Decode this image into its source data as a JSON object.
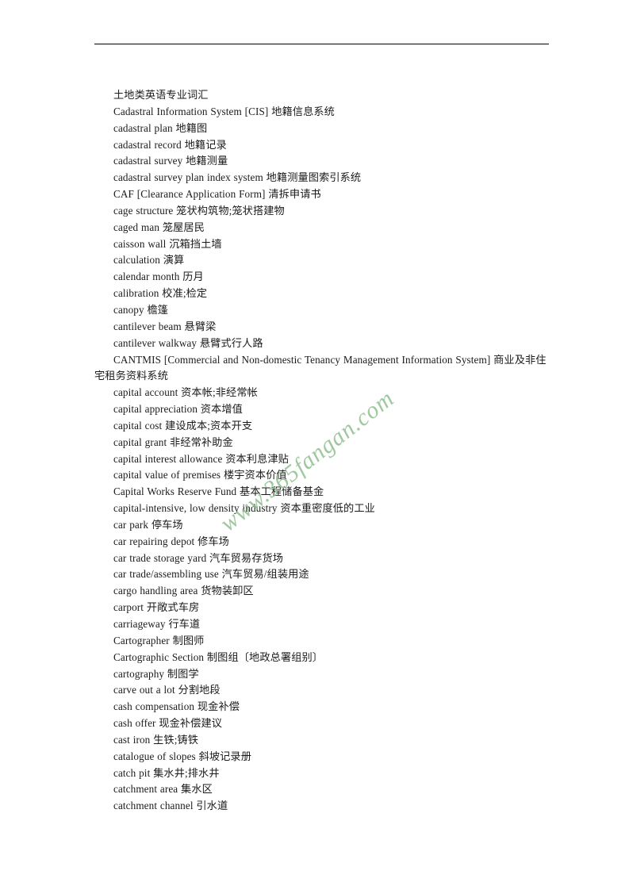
{
  "document": {
    "title": "土地类英语专业词汇",
    "header_rule": true,
    "watermark": {
      "text": "www.365fangan.com",
      "color": "#8fbf8f",
      "rotation_deg": -38
    }
  },
  "entries": [
    {
      "line": "土地类英语专业词汇"
    },
    {
      "line": "Cadastral Information System [CIS]  地籍信息系统"
    },
    {
      "line": "cadastral plan  地籍图"
    },
    {
      "line": "cadastral record  地籍记录"
    },
    {
      "line": "cadastral survey  地籍测量"
    },
    {
      "line": "cadastral survey plan index system  地籍测量图索引系统"
    },
    {
      "line": "CAF [Clearance Application Form]  清拆申请书"
    },
    {
      "line": "cage structure  笼状构筑物;笼状搭建物"
    },
    {
      "line": "caged man  笼屋居民"
    },
    {
      "line": "caisson wall  沉箱挡土墙"
    },
    {
      "line": "calculation  演算"
    },
    {
      "line": "calendar month  历月"
    },
    {
      "line": "calibration  校准;检定"
    },
    {
      "line": "canopy  檐篷"
    },
    {
      "line": "cantilever beam  悬臂梁"
    },
    {
      "line": "cantilever walkway  悬臂式行人路"
    },
    {
      "line": "CANTMIS [Commercial and Non-domestic Tenancy Management Information System]  商业及非住宅租务资料系统"
    },
    {
      "line": "capital account  资本帐;非经常帐"
    },
    {
      "line": "capital appreciation  资本增值"
    },
    {
      "line": "capital cost  建设成本;资本开支"
    },
    {
      "line": "capital grant  非经常补助金"
    },
    {
      "line": "capital interest allowance  资本利息津贴"
    },
    {
      "line": "capital value of premises  楼宇资本价值"
    },
    {
      "line": "Capital Works Reserve Fund  基本工程储备基金"
    },
    {
      "line": "capital-intensive, low density industry  资本重密度低的工业"
    },
    {
      "line": "car park  停车场"
    },
    {
      "line": "car repairing depot  修车场"
    },
    {
      "line": "car trade storage yard  汽车贸易存货场"
    },
    {
      "line": "car trade/assembling use  汽车贸易/组装用途"
    },
    {
      "line": "cargo handling area  货物装卸区"
    },
    {
      "line": "carport  开敞式车房"
    },
    {
      "line": "carriageway  行车道"
    },
    {
      "line": "Cartographer  制图师"
    },
    {
      "line": "Cartographic Section  制图组〔地政总署组别〕"
    },
    {
      "line": "cartography  制图学"
    },
    {
      "line": "carve out a lot  分割地段"
    },
    {
      "line": "cash compensation  现金补偿"
    },
    {
      "line": "cash offer  现金补偿建议"
    },
    {
      "line": "cast iron  生铁;铸铁"
    },
    {
      "line": "catalogue of slopes  斜坡记录册"
    },
    {
      "line": "catch pit  集水井;排水井"
    },
    {
      "line": "catchment area  集水区"
    },
    {
      "line": "catchment channel  引水道"
    }
  ]
}
